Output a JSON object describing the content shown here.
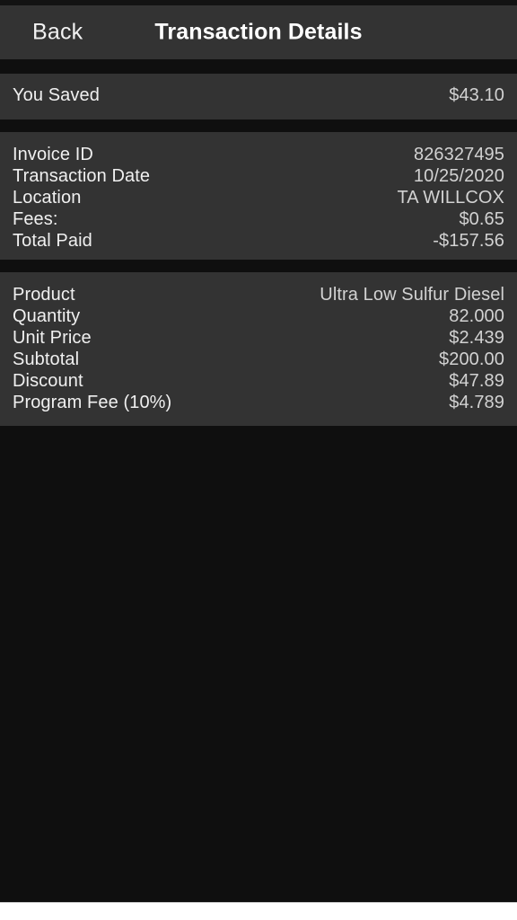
{
  "navbar": {
    "back_label": "Back",
    "title": "Transaction Details"
  },
  "colors": {
    "page_background": "#0f0f0f",
    "card_background": "#333333",
    "label_text": "#f0f0f0",
    "value_text": "#d2d2d2",
    "title_text": "#ffffff"
  },
  "sections": [
    {
      "name": "savings",
      "rows": [
        {
          "label": "You Saved",
          "value": "$43.10"
        }
      ]
    },
    {
      "name": "details",
      "rows": [
        {
          "label": "Invoice ID",
          "value": "826327495"
        },
        {
          "label": "Transaction Date",
          "value": "10/25/2020"
        },
        {
          "label": "Location",
          "value": "TA WILLCOX"
        },
        {
          "label": "Fees:",
          "value": "$0.65"
        },
        {
          "label": "Total Paid",
          "value": "-$157.56"
        }
      ]
    },
    {
      "name": "product",
      "rows": [
        {
          "label": "Product",
          "value": "Ultra Low Sulfur Diesel"
        },
        {
          "label": "Quantity",
          "value": "82.000"
        },
        {
          "label": "Unit Price",
          "value": "$2.439"
        },
        {
          "label": "Subtotal",
          "value": "$200.00"
        },
        {
          "label": "Discount",
          "value": "$47.89"
        },
        {
          "label": "Program Fee (10%)",
          "value": "$4.789"
        }
      ]
    }
  ]
}
